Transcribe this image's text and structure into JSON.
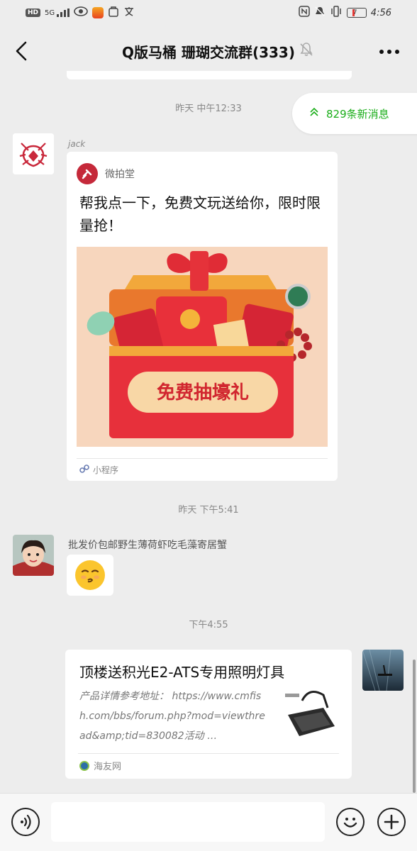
{
  "status_bar": {
    "hd": "HD",
    "network": "5G",
    "battery": "7",
    "time": "4:56"
  },
  "header": {
    "title": "Q版马桶 珊瑚交流群(333)"
  },
  "unread_banner": {
    "label": "829条新消息"
  },
  "timestamps": [
    "昨天 中午12:33",
    "昨天 下午5:41",
    "下午4:55"
  ],
  "messages": {
    "m1": {
      "sender": "jack",
      "mini_program": {
        "name": "微拍堂",
        "text": "帮我点一下，免费文玩送给你，限时限量抢！",
        "banner_text": "免费抽壕礼",
        "footer": "小程序"
      }
    },
    "m2": {
      "sender_text": "批发价包邮野生薄荷虾吃毛藻寄居蟹",
      "emoji": "😚"
    },
    "m3": {
      "link": {
        "title": "顶楼送积光E2-ATS专用照明灯具",
        "description": "产品详情参考地址： https://www.cmfish.com/bbs/forum.php?mod=viewthread&amp;tid=830082活动 …",
        "source": "海友网"
      }
    }
  }
}
